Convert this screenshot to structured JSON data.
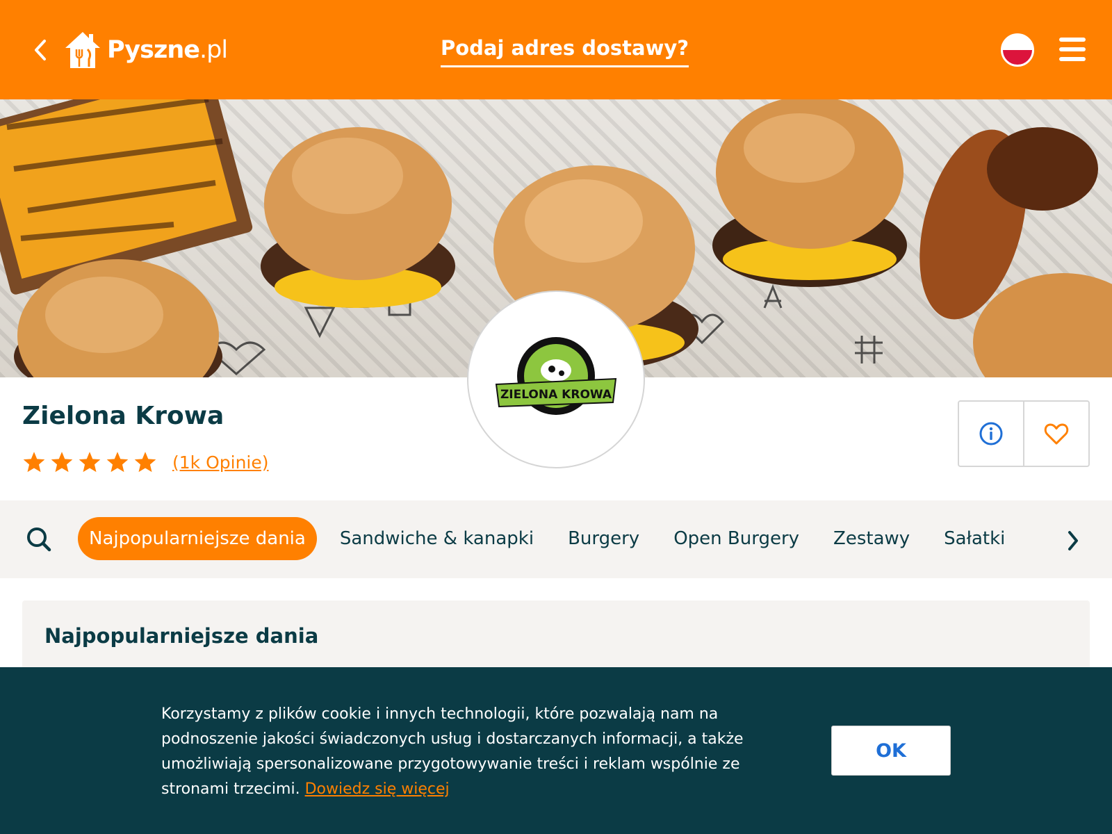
{
  "header": {
    "logo_main": "Pyszne",
    "logo_suffix": ".pl",
    "address_prompt": "Podaj adres dostawy?",
    "color": "#ff8000"
  },
  "hero": {
    "logo_text": "ZIELONA KROWA"
  },
  "restaurant": {
    "name": "Zielona Krowa",
    "rating_stars": 5,
    "reviews_label": "(1k Opinie)"
  },
  "categories": {
    "items": [
      {
        "label": "Najpopularniejsze dania",
        "active": true
      },
      {
        "label": "Sandwiche & kanapki"
      },
      {
        "label": "Burgery"
      },
      {
        "label": "Open Burgery"
      },
      {
        "label": "Zestawy"
      },
      {
        "label": "Sałatki"
      }
    ]
  },
  "section": {
    "title": "Najpopularniejsze dania"
  },
  "cookie": {
    "text": "Korzystamy z plików cookie i innych technologii, które pozwalają nam na podnoszenie jakości świadczonych usług i dostarczanych informacji, a także umożliwiają spersonalizowane przygotowywanie treści i reklam wspólnie ze stronami trzecimi.",
    "link": "Dowiedz się więcej",
    "ok_label": "OK"
  },
  "icons": {
    "back": "chevron-left-icon",
    "logo": "home-fork-knife-icon",
    "flag": "poland-flag-icon",
    "menu": "hamburger-menu-icon",
    "search": "search-icon",
    "info": "info-icon",
    "favorite": "heart-icon",
    "next": "chevron-right-icon",
    "star": "star-icon"
  },
  "colors": {
    "brand": "#ff8000",
    "dark": "#0b3b45",
    "link_blue": "#1f6fd6",
    "panel": "#f5f3f1"
  }
}
